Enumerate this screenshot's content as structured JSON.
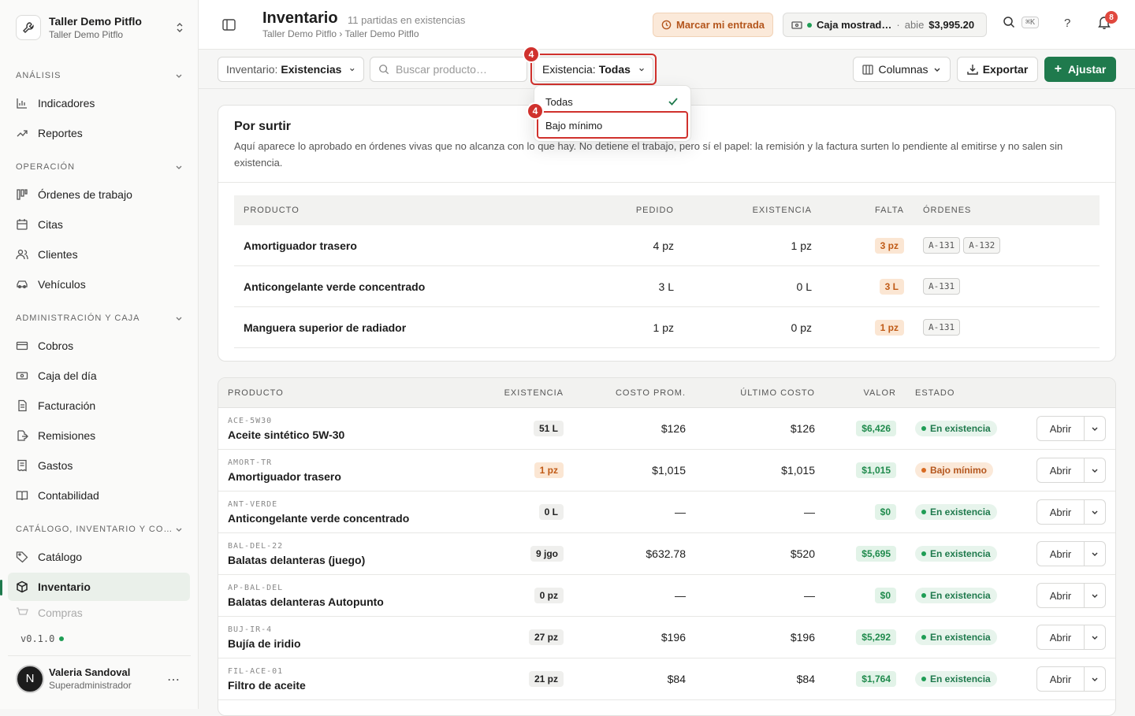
{
  "workspace": {
    "name": "Taller Demo Pitflo",
    "sub": "Taller Demo Pitflo"
  },
  "sidebar": {
    "sections": [
      {
        "label": "ANÁLISIS",
        "items": [
          "Indicadores",
          "Reportes"
        ]
      },
      {
        "label": "OPERACIÓN",
        "items": [
          "Órdenes de trabajo",
          "Citas",
          "Clientes",
          "Vehículos"
        ]
      },
      {
        "label": "ADMINISTRACIÓN Y CAJA",
        "items": [
          "Cobros",
          "Caja del día",
          "Facturación",
          "Remisiones",
          "Gastos",
          "Contabilidad"
        ]
      },
      {
        "label": "CATÁLOGO, INVENTARIO Y CO…",
        "items": [
          "Catálogo",
          "Inventario",
          "Compras"
        ]
      }
    ],
    "active": "Inventario",
    "version": "v0.1.0",
    "user": {
      "initial": "N",
      "name": "Valeria Sandoval",
      "role": "Superadministrador"
    }
  },
  "header": {
    "title": "Inventario",
    "count": "11 partidas en existencias",
    "breadcrumb": "Taller Demo Pitflo › Taller Demo Pitflo",
    "entry_button": "Marcar mi entrada",
    "caja": {
      "name": "Caja mostrad…",
      "sep": "·",
      "state": "abie",
      "amount": "$3,995.20"
    },
    "shortcut": "⌘K",
    "help": "?",
    "notifications": "8"
  },
  "toolbar": {
    "inventario": {
      "label": "Inventario:",
      "value": "Existencias"
    },
    "search_placeholder": "Buscar producto…",
    "existencia": {
      "label": "Existencia:",
      "value": "Todas"
    },
    "step_badge": "4",
    "columns": "Columnas",
    "export": "Exportar",
    "adjust": "Ajustar"
  },
  "dropdown": {
    "options": [
      "Todas",
      "Bajo mínimo"
    ],
    "selected": "Todas",
    "badge": "4"
  },
  "por_surtir": {
    "title": "Por surtir",
    "description": "Aquí aparece lo aprobado en órdenes vivas que no alcanza con lo que hay. No detiene el trabajo, pero sí el papel: la remisión y la factura surten lo pendiente al emitirse y no salen sin existencia.",
    "columns": [
      "PRODUCTO",
      "PEDIDO",
      "EXISTENCIA",
      "FALTA",
      "ÓRDENES"
    ],
    "rows": [
      {
        "product": "Amortiguador trasero",
        "ordered": "4 pz",
        "stock": "1 pz",
        "missing": "3 pz",
        "orders": [
          "A-131",
          "A-132"
        ]
      },
      {
        "product": "Anticongelante verde concentrado",
        "ordered": "3 L",
        "stock": "0 L",
        "missing": "3 L",
        "orders": [
          "A-131"
        ]
      },
      {
        "product": "Manguera superior de radiador",
        "ordered": "1 pz",
        "stock": "0 pz",
        "missing": "1 pz",
        "orders": [
          "A-131"
        ]
      }
    ]
  },
  "inventory": {
    "columns": [
      "PRODUCTO",
      "EXISTENCIA",
      "COSTO PROM.",
      "ÚLTIMO COSTO",
      "VALOR",
      "ESTADO"
    ],
    "open_label": "Abrir",
    "rows": [
      {
        "sku": "ACE-5W30",
        "name": "Aceite sintético 5W-30",
        "stock": "51 L",
        "avg": "$126",
        "last": "$126",
        "value": "$6,426",
        "status": "En existencia",
        "low": false
      },
      {
        "sku": "AMORT-TR",
        "name": "Amortiguador trasero",
        "stock": "1 pz",
        "avg": "$1,015",
        "last": "$1,015",
        "value": "$1,015",
        "status": "Bajo mínimo",
        "low": true
      },
      {
        "sku": "ANT-VERDE",
        "name": "Anticongelante verde concentrado",
        "stock": "0 L",
        "avg": "—",
        "last": "—",
        "value": "$0",
        "status": "En existencia",
        "low": false
      },
      {
        "sku": "BAL-DEL-22",
        "name": "Balatas delanteras (juego)",
        "stock": "9 jgo",
        "avg": "$632.78",
        "last": "$520",
        "value": "$5,695",
        "status": "En existencia",
        "low": false
      },
      {
        "sku": "AP-BAL-DEL",
        "name": "Balatas delanteras Autopunto",
        "stock": "0 pz",
        "avg": "—",
        "last": "—",
        "value": "$0",
        "status": "En existencia",
        "low": false
      },
      {
        "sku": "BUJ-IR-4",
        "name": "Bujía de iridio",
        "stock": "27 pz",
        "avg": "$196",
        "last": "$196",
        "value": "$5,292",
        "status": "En existencia",
        "low": false
      },
      {
        "sku": "FIL-ACE-01",
        "name": "Filtro de aceite",
        "stock": "21 pz",
        "avg": "$84",
        "last": "$84",
        "value": "$1,764",
        "status": "En existencia",
        "low": false
      }
    ]
  }
}
